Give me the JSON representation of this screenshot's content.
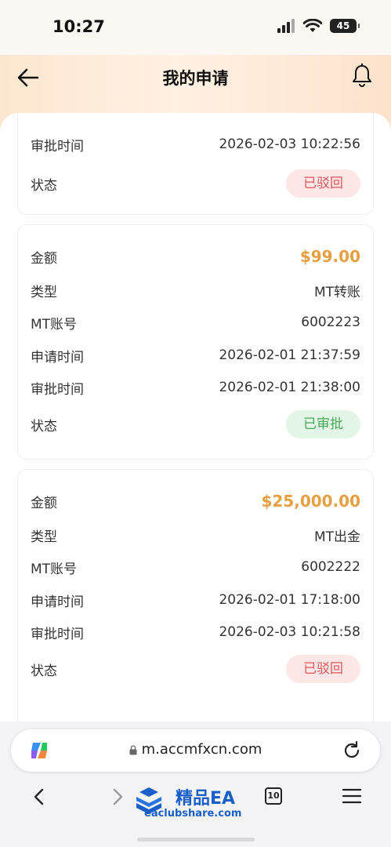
{
  "status_bar": {
    "time": "10:27",
    "battery": "45"
  },
  "nav": {
    "title": "我的申请"
  },
  "records": [
    {
      "rows": [
        {
          "key": "审批时间",
          "value": "2026-02-03 10:22:56"
        }
      ],
      "status_label": "状态",
      "status": "已驳回",
      "status_kind": "rejected"
    },
    {
      "amount_label": "金额",
      "amount": "$99.00",
      "rows": [
        {
          "key": "类型",
          "value": "MT转账"
        },
        {
          "key": "MT账号",
          "value": "6002223"
        },
        {
          "key": "申请时间",
          "value": "2026-02-01 21:37:59"
        },
        {
          "key": "审批时间",
          "value": "2026-02-01 21:38:00"
        }
      ],
      "status_label": "状态",
      "status": "已审批",
      "status_kind": "approved"
    },
    {
      "amount_label": "金额",
      "amount": "$25,000.00",
      "rows": [
        {
          "key": "类型",
          "value": "MT出金"
        },
        {
          "key": "MT账号",
          "value": "6002222"
        },
        {
          "key": "申请时间",
          "value": "2026-02-01 17:18:00"
        },
        {
          "key": "审批时间",
          "value": "2026-02-03 10:21:58"
        }
      ],
      "status_label": "状态",
      "status": "已驳回",
      "status_kind": "rejected"
    }
  ],
  "browser": {
    "url": "m.accmfxcn.com",
    "tab_count": "10"
  },
  "watermark": {
    "title": "精品EA",
    "subtitle": "eaclubshare.com"
  },
  "colors": {
    "amount": "#e6a043",
    "rejected": "#e0565b",
    "approved": "#47a758",
    "link": "#1a5fc8"
  }
}
